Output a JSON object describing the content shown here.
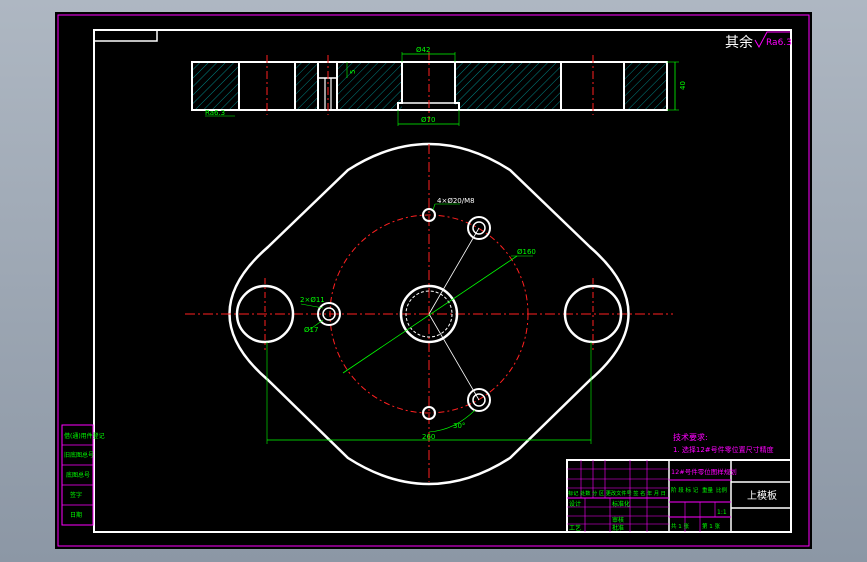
{
  "drawing": {
    "roughness_note": {
      "label": "其余",
      "value": "Ra6.3"
    },
    "dims": {
      "bore_top": "Ø42",
      "bore_bottom": "Ø70",
      "thickness": "40",
      "slot_depth": "5",
      "edge_roughness": "Ra6.3",
      "bolt_circle": "Ø160",
      "hole_spec": "2×Ø11",
      "small_hole_note": "4×Ø20/M8",
      "counterbore": "Ø17",
      "span": "260",
      "angle": "30°"
    },
    "tech_requirements": {
      "title": "技术要求:",
      "line1": "1. 选择12#号件零位置尺寸精度"
    }
  },
  "title_block": {
    "drawing_name": "12#号件零位图样规划",
    "part_name": "上模板",
    "mid_row": "标记 处数 分 区 更改文件号 签 名 年 月 日",
    "labels": {
      "design": "设计",
      "process": "工艺",
      "standard": "标准化",
      "review": "审核",
      "approve": "批准",
      "stage": "阶 段 标 记",
      "weight": "重量",
      "scale": "比例",
      "ratio": "1:1",
      "sheet_total": "共 1 张",
      "sheet_no": "第 1 张"
    }
  },
  "side_table": [
    "借(通)用件登记",
    "旧底图总号",
    "底图总号",
    "签字",
    "日期"
  ]
}
